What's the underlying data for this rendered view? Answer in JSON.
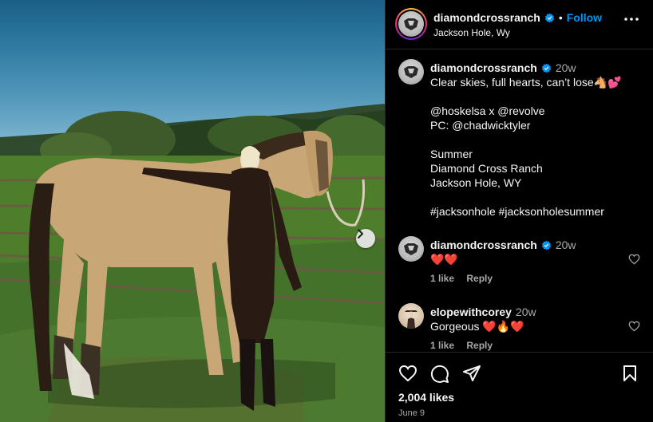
{
  "post": {
    "username": "diamondcrossranch",
    "location": "Jackson Hole, Wy",
    "follow_label": "Follow",
    "dot": "•"
  },
  "caption": {
    "username": "diamondcrossranch",
    "time": "20w",
    "text": "Clear skies, full hearts, can’t lose🐴💕\n\n@hoskelsa x @revolve\nPC: @chadwicktyler\n\nSummer\nDiamond Cross Ranch\nJackson Hole, WY\n\n#jacksonhole #jacksonholesummer"
  },
  "comments": [
    {
      "username": "diamondcrossranch",
      "verified": true,
      "time": "20w",
      "text": "❤️❤️",
      "likes_label": "1 like",
      "reply_label": "Reply"
    },
    {
      "username": "elopewithcorey",
      "verified": false,
      "time": "20w",
      "text": "Gorgeous ❤️🔥❤️",
      "likes_label": "1 like",
      "reply_label": "Reply"
    }
  ],
  "footer": {
    "likes": "2,004 likes",
    "date": "June 9"
  },
  "colors": {
    "accent": "#0095f6",
    "verified": "#0095f6",
    "muted": "#a8a8a8"
  },
  "icons": [
    "verified-badge-icon",
    "more-icon",
    "heart-icon",
    "comment-icon",
    "share-icon",
    "bookmark-icon",
    "chevron-right-icon"
  ]
}
